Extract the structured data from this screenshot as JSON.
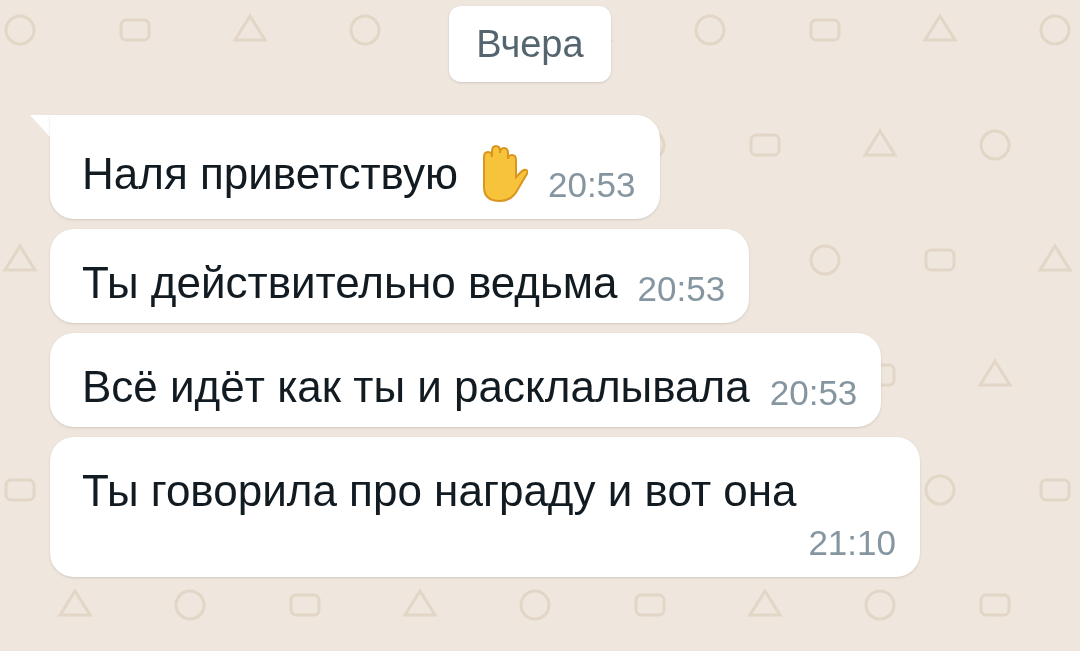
{
  "date_divider": "Вчера",
  "messages": [
    {
      "text": "Наля приветствую",
      "emoji": true,
      "time": "20:53",
      "first": true
    },
    {
      "text": "Ты действительно ведьма",
      "emoji": false,
      "time": "20:53",
      "first": false
    },
    {
      "text": "Всё идёт как ты и расклалывала",
      "emoji": false,
      "time": "20:53",
      "first": false
    },
    {
      "text": "Ты говорила про награду и вот она",
      "emoji": false,
      "time": "21:10",
      "first": false
    }
  ]
}
